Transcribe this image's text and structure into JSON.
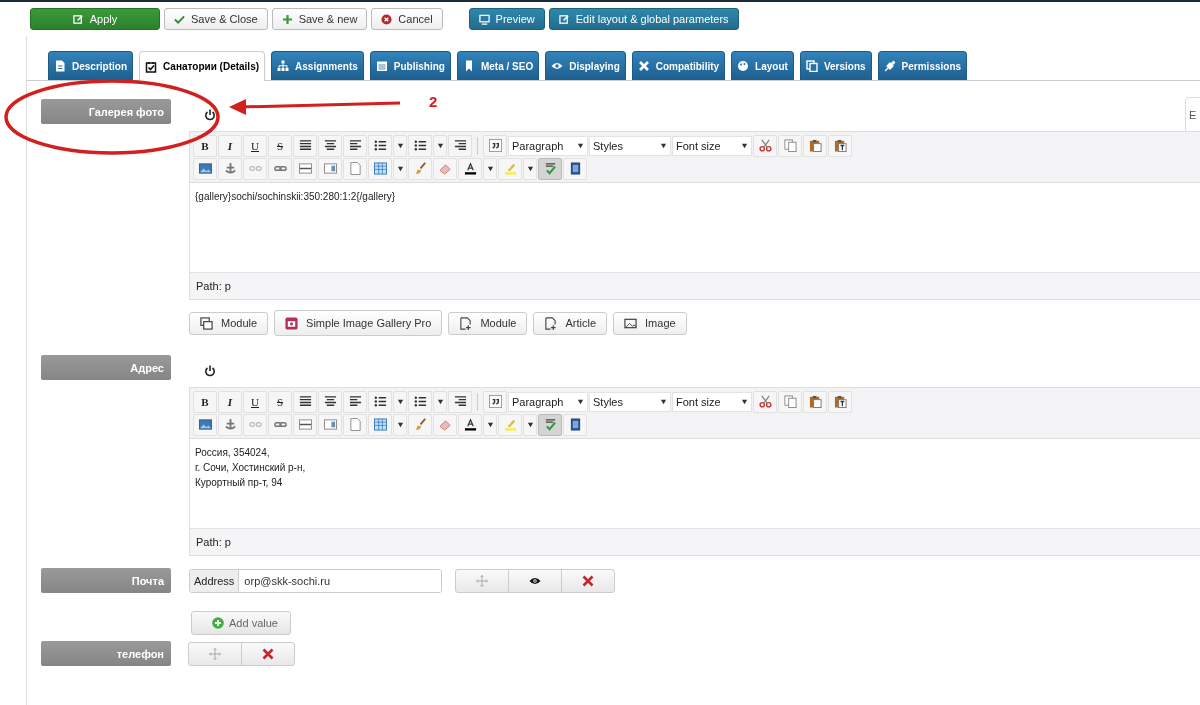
{
  "toolbar": {
    "buttons": [
      {
        "label": "Apply",
        "kind": "apply"
      },
      {
        "label": "Save & Close",
        "kind": "save"
      },
      {
        "label": "Save & new",
        "kind": "new"
      },
      {
        "label": "Cancel",
        "kind": "cancel"
      },
      {
        "label": "Preview",
        "kind": "preview"
      },
      {
        "label": "Edit layout & global parameters",
        "kind": "layout"
      }
    ]
  },
  "tabs": [
    {
      "label": "Description",
      "selected": false
    },
    {
      "label": "Санатории (Details)",
      "selected": true
    },
    {
      "label": "Assignments",
      "selected": false
    },
    {
      "label": "Publishing",
      "selected": false
    },
    {
      "label": "Meta / SEO",
      "selected": false
    },
    {
      "label": "Displaying",
      "selected": false
    },
    {
      "label": "Compatibility",
      "selected": false
    },
    {
      "label": "Layout",
      "selected": false
    },
    {
      "label": "Versions",
      "selected": false
    },
    {
      "label": "Permissions",
      "selected": false
    }
  ],
  "fields": [
    {
      "label": "Галерея фото",
      "kind": "editor",
      "side_tab": "E",
      "editor": {
        "format_buttons": [
          "B",
          "I",
          "U",
          "S"
        ],
        "selects": [
          "Paragraph",
          "Styles",
          "Font size"
        ],
        "spellcheck": true,
        "lines": [
          "{gallery}sochi/sochinskii:350:280:1:2{/gallery}"
        ],
        "path": "Path: p"
      },
      "buttons": [
        {
          "label": "Module",
          "kind": "module"
        },
        {
          "label": "Simple Image Gallery Pro",
          "kind": "gallery"
        },
        {
          "label": "Module",
          "kind": "insert"
        },
        {
          "label": "Article",
          "kind": "insert"
        },
        {
          "label": "Image",
          "kind": "image"
        }
      ]
    },
    {
      "label": "Адрес",
      "kind": "editor",
      "editor": {
        "format_buttons": [
          "B",
          "I",
          "U",
          "S"
        ],
        "selects": [
          "Paragraph",
          "Styles",
          "Font size"
        ],
        "spellcheck": true,
        "lines": [
          "Россия, 354024,",
          "г. Сочи, Хостинский р-н,",
          "Курортный пр-т, 94"
        ],
        "path": "Path: p"
      }
    },
    {
      "label": "Почта",
      "kind": "email",
      "prefix": "Address",
      "value": "orp@skk-sochi.ru",
      "add_button": "Add value"
    },
    {
      "label": "телефон",
      "kind": "phone"
    }
  ],
  "annotation": {
    "label": "2"
  }
}
